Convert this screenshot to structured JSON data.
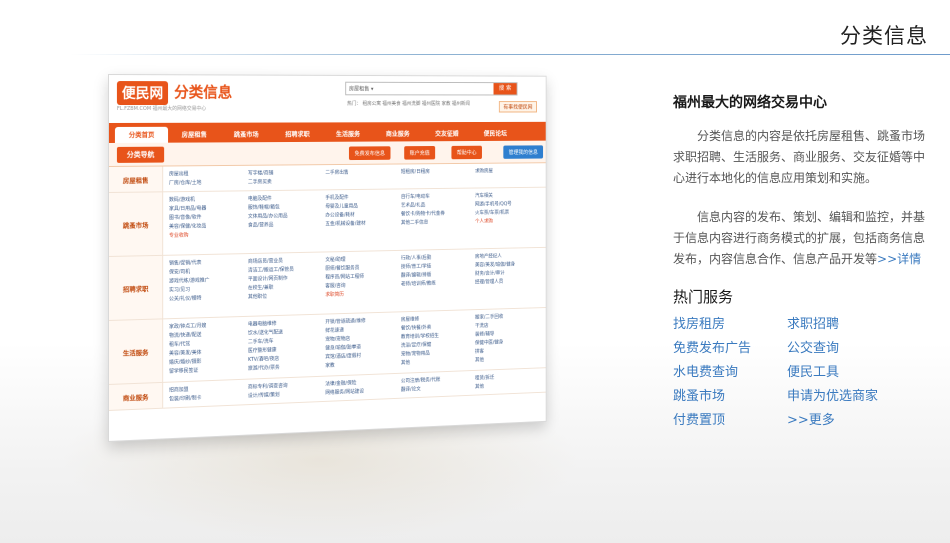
{
  "page": {
    "title": "分类信息",
    "accent_color": "#6f9ccc",
    "brand_color": "#e8541a"
  },
  "screenshot": {
    "logo": "便民网",
    "site_title": "分类信息",
    "site_subtitle": "FL.FZBM.COM 福州最大的网络交易中心",
    "search_select": "房屋租售 ▾",
    "search_button": "搜 索",
    "hot_links": "热门：  租房公寓  福州美食  福州洗脚  福州医院  家教  福州新闻",
    "post_button": "有事找便民网",
    "nav": [
      "分类首页",
      "房屋租售",
      "跳蚤市场",
      "招聘求职",
      "生活服务",
      "商业服务",
      "交友征婚",
      "便民论坛"
    ],
    "sub_tab": "分类导航",
    "sub_buttons": [
      {
        "label": "免费发布信息",
        "color": "#e8541a"
      },
      {
        "label": "账户充值",
        "color": "#e8541a"
      },
      {
        "label": "帮助中心",
        "color": "#e8541a"
      },
      {
        "label": "管理我的信息",
        "color": "#2f7fcf"
      }
    ],
    "rows": [
      {
        "category": "房屋租售",
        "size": "short",
        "columns": [
          [
            {
              "t": "房屋出租"
            },
            {
              "t": "厂房/仓库/土地"
            }
          ],
          [
            {
              "t": "写字楼/商铺"
            },
            {
              "t": "二手房买卖"
            }
          ],
          [
            {
              "t": "二手房出售"
            }
          ],
          [
            {
              "t": "短租房/日租房"
            }
          ],
          [
            {
              "t": "求购房屋"
            }
          ]
        ]
      },
      {
        "category": "跳蚤市场",
        "size": "tall",
        "columns": [
          [
            {
              "t": "数码/游戏机"
            },
            {
              "t": "家具/日用品/电器"
            },
            {
              "t": "图书/音像/软件"
            },
            {
              "t": "美容/保健/化妆品"
            },
            {
              "t": "专业收购",
              "red": true
            }
          ],
          [
            {
              "t": "电脑及配件"
            },
            {
              "t": "服饰/鞋帽/箱包"
            },
            {
              "t": "文体用品/办公用品"
            },
            {
              "t": "食品/营养品"
            }
          ],
          [
            {
              "t": "手机及配件"
            },
            {
              "t": "母婴及儿童用品"
            },
            {
              "t": "办公设备/耗材"
            },
            {
              "t": "五金/机械设备/建材"
            }
          ],
          [
            {
              "t": "自行车/电动车"
            },
            {
              "t": "艺术品/礼品"
            },
            {
              "t": "餐饮卡/购物卡/代金券"
            },
            {
              "t": "其他二手信息"
            }
          ],
          [
            {
              "t": "汽车相关"
            },
            {
              "t": "网游/手机号/QQ号"
            },
            {
              "t": "火车票/车票/机票"
            },
            {
              "t": "个人求购",
              "red": true
            }
          ]
        ]
      },
      {
        "category": "招聘求职",
        "size": "tall",
        "columns": [
          [
            {
              "t": "销售/促销/代表"
            },
            {
              "t": "保安/司机"
            },
            {
              "t": "游戏代练/游戏推广"
            },
            {
              "t": "实习/见习"
            },
            {
              "t": "公关/礼仪/模特"
            }
          ],
          [
            {
              "t": "商场店员/营业员"
            },
            {
              "t": "清洁工/搬运工/保管员"
            },
            {
              "t": "平面设计/网页制作"
            },
            {
              "t": "在校生/兼职"
            },
            {
              "t": "其他职位"
            }
          ],
          [
            {
              "t": "文秘/助理"
            },
            {
              "t": "厨师/餐饮服务员"
            },
            {
              "t": "程序员/网站工程师"
            },
            {
              "t": "客服/咨询"
            },
            {
              "t": "求职简历",
              "red": true
            }
          ],
          [
            {
              "t": "行政/人事/后勤"
            },
            {
              "t": "技师/普工/学徒"
            },
            {
              "t": "翻译/编辑/排版"
            },
            {
              "t": "老师/培训师/教练"
            }
          ],
          [
            {
              "t": "房地产经纪人"
            },
            {
              "t": "美容/美发/瑜伽/健身"
            },
            {
              "t": "财务/会计/审计"
            },
            {
              "t": "经理/管理人员"
            }
          ]
        ]
      },
      {
        "category": "生活服务",
        "size": "tall",
        "columns": [
          [
            {
              "t": "家政/钟点工/月嫂"
            },
            {
              "t": "物流/快递/配送"
            },
            {
              "t": "租车/代驾"
            },
            {
              "t": "美容/美发/美体"
            },
            {
              "t": "婚庆/婚纱/摄影"
            },
            {
              "t": "留学移民签证"
            }
          ],
          [
            {
              "t": "电器电脑维修"
            },
            {
              "t": "饮水/送化气配送"
            },
            {
              "t": "二手车/洗车"
            },
            {
              "t": "医疗整形健康"
            },
            {
              "t": "KTV/酒吧/夜店"
            },
            {
              "t": "旅游/代办/票务"
            }
          ],
          [
            {
              "t": "开锁/管道疏通/维修"
            },
            {
              "t": "鲜花速递"
            },
            {
              "t": "宠物/宠物店"
            },
            {
              "t": "健身/瑜伽/跆拳道"
            },
            {
              "t": "宾馆/酒店/度假村"
            },
            {
              "t": "家教"
            }
          ],
          [
            {
              "t": "房屋维修"
            },
            {
              "t": "餐饮/快餐/外卖"
            },
            {
              "t": "教育培训/学校招生"
            },
            {
              "t": "洗浴/足疗/保健"
            },
            {
              "t": "宠物/宠物用品"
            },
            {
              "t": "其他"
            }
          ],
          [
            {
              "t": "搬家/二手回收"
            },
            {
              "t": "干洗店"
            },
            {
              "t": "装修/辅导"
            },
            {
              "t": "保健中医/健身"
            },
            {
              "t": "拼客"
            },
            {
              "t": "其他"
            }
          ]
        ]
      },
      {
        "category": "商业服务",
        "size": "short",
        "columns": [
          [
            {
              "t": "招商加盟"
            },
            {
              "t": "包装/印刷/制卡"
            }
          ],
          [
            {
              "t": "商标专利/调查咨询"
            },
            {
              "t": "设计/传媒/策划"
            }
          ],
          [
            {
              "t": "法律/金融/保险"
            },
            {
              "t": "网络服务/网站建设"
            }
          ],
          [
            {
              "t": "公司注册/税务/代账"
            },
            {
              "t": "翻译/论文"
            }
          ],
          [
            {
              "t": "租赁/拆迁"
            },
            {
              "t": "其他"
            }
          ]
        ]
      }
    ]
  },
  "info": {
    "heading": "福州最大的网络交易中心",
    "para1": "分类信息的内容是依托房屋租售、跳蚤市场求职招聘、生活服务、商业服务、交友征婚等中心进行本地化的信息应用策划和实施。",
    "para2": "信息内容的发布、策划、编辑和监控，并基于信息内容进行商务模式的扩展，包括商务信息发布，内容信息合作、信息产品开发等",
    "more_link": ">>详情"
  },
  "services": {
    "heading": "热门服务",
    "links": [
      "找房租房",
      "求职招聘",
      "免费发布广告",
      "公交查询",
      "水电费查询",
      "便民工具",
      "跳蚤市场",
      "申请为优选商家",
      "付费置顶",
      ">>更多"
    ]
  }
}
